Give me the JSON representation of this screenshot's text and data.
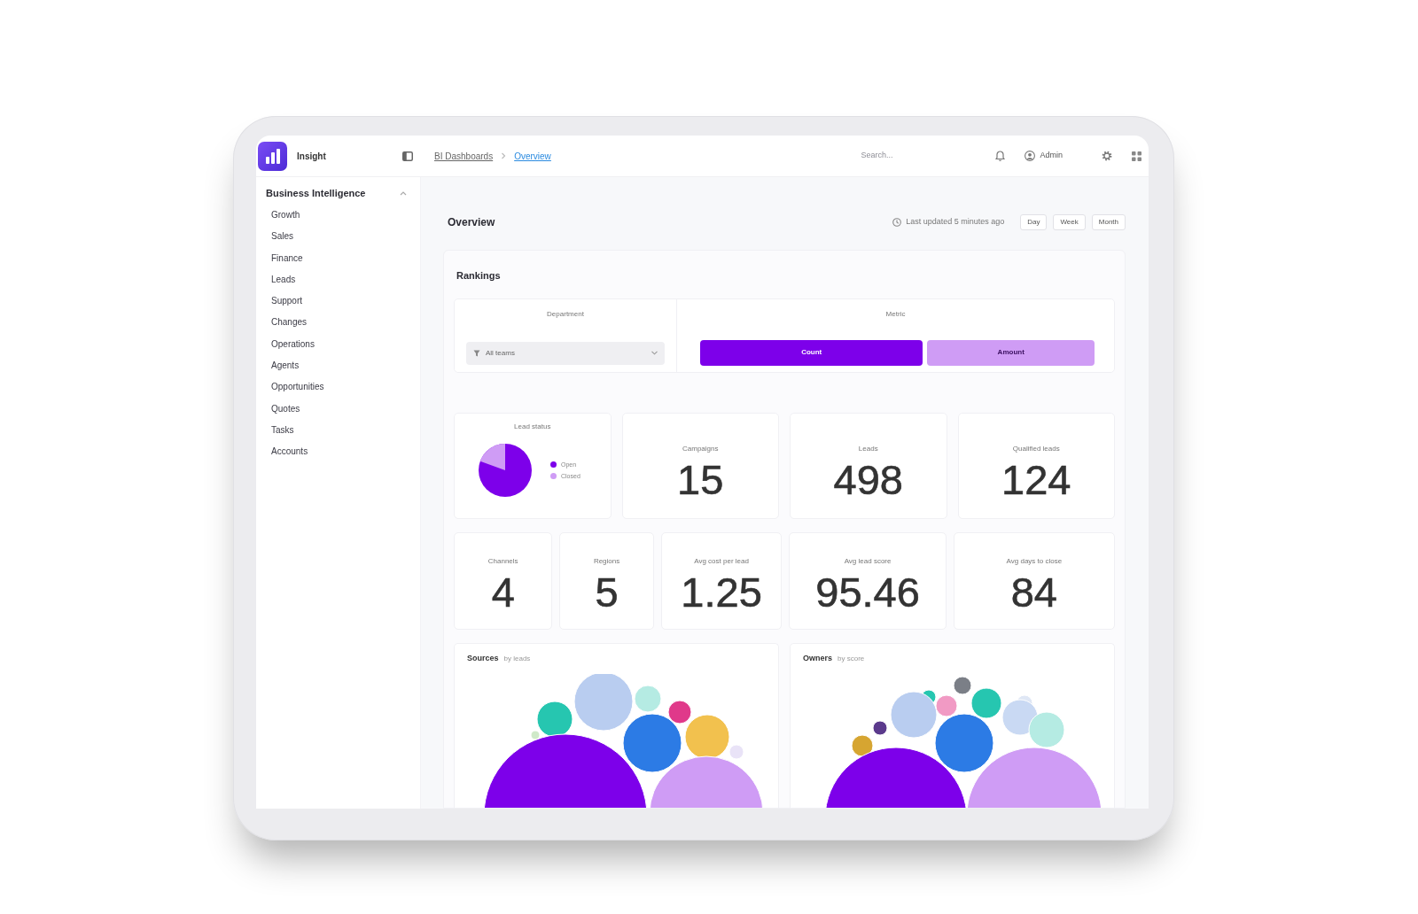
{
  "app": {
    "name": "Insight"
  },
  "breadcrumb": [
    {
      "label": "BI Dashboards",
      "current": false
    },
    {
      "label": "Overview",
      "current": true
    }
  ],
  "search": {
    "placeholder": "Search..."
  },
  "user": {
    "name": "Admin"
  },
  "sidebar": {
    "title": "Business Intelligence",
    "items": [
      "Growth",
      "Sales",
      "Finance",
      "Leads",
      "Support",
      "Changes",
      "Operations",
      "Agents",
      "Opportunities",
      "Quotes",
      "Tasks",
      "Accounts"
    ]
  },
  "page": {
    "title": "Overview",
    "updated": "Last updated 5 minutes ago",
    "ranges": [
      "Day",
      "Week",
      "Month"
    ]
  },
  "rankings": {
    "title": "Rankings",
    "filters": [
      {
        "kind": "select",
        "label": "Department",
        "value": "All teams"
      },
      {
        "kind": "toggle",
        "label": "Metric",
        "options": [
          {
            "label": "Count",
            "selected": true
          },
          {
            "label": "Amount",
            "selected": false
          }
        ]
      }
    ]
  },
  "kpi_rows": [
    [
      {
        "kind": "pie",
        "title": "Lead status",
        "legend": [
          {
            "label": "Open",
            "color": "#7d00ea"
          },
          {
            "label": "Closed",
            "color": "#cf9cf5"
          }
        ]
      },
      {
        "kind": "number",
        "label": "Campaigns",
        "value": "15"
      },
      {
        "kind": "number",
        "label": "Leads",
        "value": "498"
      },
      {
        "kind": "number",
        "label": "Qualified leads",
        "value": "124"
      }
    ],
    [
      {
        "kind": "number",
        "label": "Channels",
        "value": "4"
      },
      {
        "kind": "number",
        "label": "Regions",
        "value": "5"
      },
      {
        "kind": "number",
        "label": "Avg cost per lead",
        "value": "1.25"
      },
      {
        "kind": "number",
        "label": "Avg lead score",
        "value": "95.46"
      },
      {
        "kind": "number",
        "label": "Avg days to close",
        "value": "84"
      }
    ]
  ],
  "charts": [
    {
      "title": "Sources",
      "subtitle": "by leads"
    },
    {
      "title": "Owners",
      "subtitle": "by score"
    }
  ]
}
